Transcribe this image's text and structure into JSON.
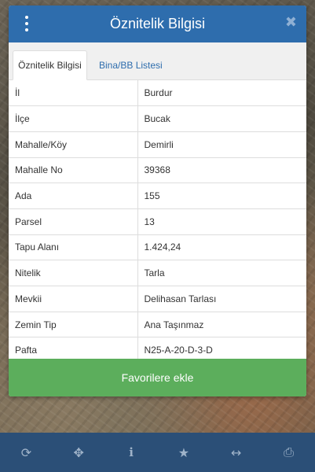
{
  "header": {
    "title": "Öznitelik Bilgisi",
    "close_glyph": "✖"
  },
  "tabs": [
    {
      "label": "Öznitelik Bilgisi",
      "active": true
    },
    {
      "label": "Bina/BB Listesi",
      "active": false
    }
  ],
  "attributes": [
    {
      "key": "İl",
      "value": "Burdur"
    },
    {
      "key": "İlçe",
      "value": "Bucak"
    },
    {
      "key": "Mahalle/Köy",
      "value": "Demirli"
    },
    {
      "key": "Mahalle No",
      "value": "39368"
    },
    {
      "key": "Ada",
      "value": "155"
    },
    {
      "key": "Parsel",
      "value": "13"
    },
    {
      "key": "Tapu Alanı",
      "value": "1.424,24"
    },
    {
      "key": "Nitelik",
      "value": "Tarla"
    },
    {
      "key": "Mevkii",
      "value": "Delihasan Tarlası"
    },
    {
      "key": "Zemin Tip",
      "value": "Ana Taşınmaz"
    },
    {
      "key": "Pafta",
      "value": "N25-A-20-D-3-D"
    }
  ],
  "favorite_button": "Favorilere ekle",
  "bottom_bar": [
    {
      "icon": "refresh-icon",
      "glyph": "⟳"
    },
    {
      "icon": "crosshair-icon",
      "glyph": "✥"
    },
    {
      "icon": "info-icon",
      "glyph": "i"
    },
    {
      "icon": "star-icon",
      "glyph": "★"
    },
    {
      "icon": "measure-icon",
      "glyph": "↔"
    },
    {
      "icon": "print-icon",
      "glyph": "⎙"
    }
  ],
  "colors": {
    "header": "#2e6dad",
    "favorite_button": "#5cae5c",
    "bottom_bar": "#2b4f77"
  }
}
